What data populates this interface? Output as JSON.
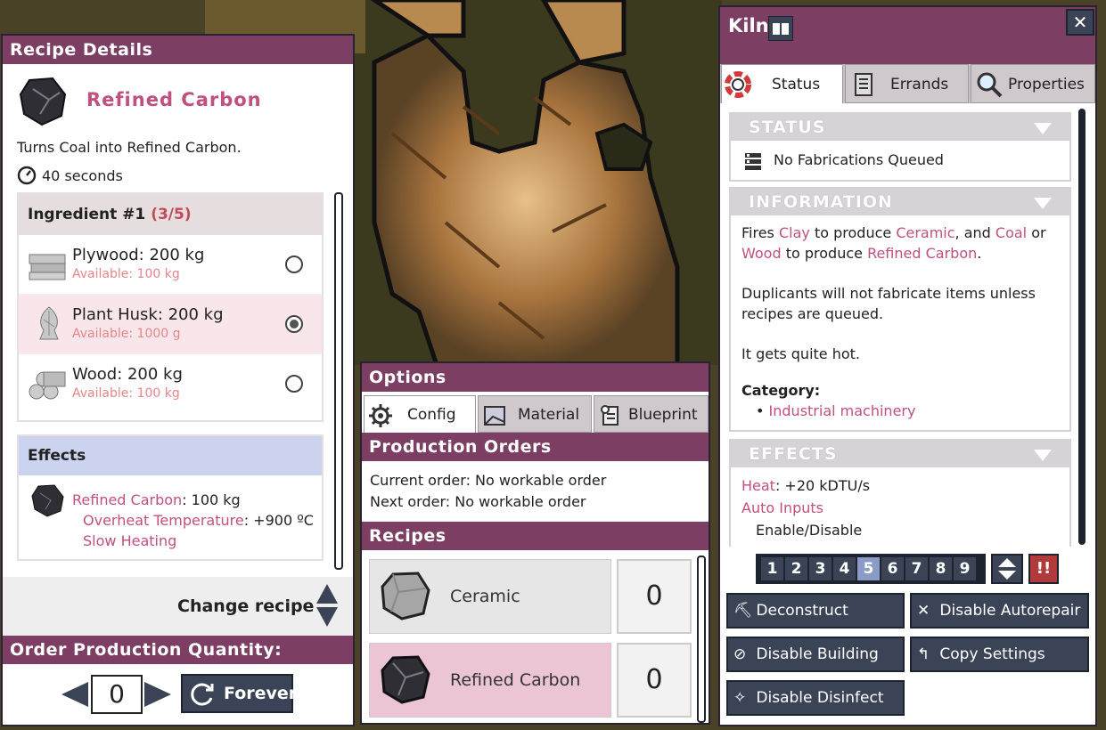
{
  "recipe_details": {
    "header": "Recipe Details",
    "name": "Refined Carbon",
    "description": "Turns Coal into Refined Carbon.",
    "time": "40 seconds",
    "ingredient_title": "Ingredient #1",
    "ingredient_count": "(3/5)",
    "ingredients": [
      {
        "name": "Plywood: 200 kg",
        "available": "Available: 100 kg",
        "selected": false
      },
      {
        "name": "Plant Husk: 200 kg",
        "available": "Available: 1000 g",
        "selected": true
      },
      {
        "name": "Wood: 200 kg",
        "available": "Available: 100 kg",
        "selected": false
      }
    ],
    "effects_title": "Effects",
    "effect_product": "Refined Carbon",
    "effect_amount": ": 100 kg",
    "effect_overheat_label": "Overheat Temperature",
    "effect_overheat_value": ": +900 ºC",
    "effect_slow": "Slow Heating",
    "change_recipe": "Change recipe",
    "order_header": "Order Production Quantity:",
    "quantity": "0",
    "forever": "Forever"
  },
  "options": {
    "header": "Options",
    "tabs": [
      "Config",
      "Material",
      "Blueprint"
    ],
    "production_orders_header": "Production Orders",
    "current_order": "Current order: No workable order",
    "next_order": "Next order: No workable order",
    "recipes_header": "Recipes",
    "recipes": [
      {
        "name": "Ceramic",
        "count": "0"
      },
      {
        "name": "Refined Carbon",
        "count": "0"
      }
    ]
  },
  "kiln": {
    "title": "Kiln",
    "close": "✕",
    "tabs": [
      "Status",
      "Errands",
      "Properties"
    ],
    "status_header": "STATUS",
    "status_text": "No Fabrications Queued",
    "info_header": "INFORMATION",
    "info_fires": "Fires ",
    "info_clay": "Clay",
    "info_to_produce": " to produce ",
    "info_ceramic": "Ceramic",
    "info_and": ", and ",
    "info_coal": "Coal",
    "info_or": " or",
    "info_wood": "Wood",
    "info_to_produce2": " to produce ",
    "info_refined": "Refined Carbon",
    "info_period": ".",
    "info_para2": "Duplicants will not fabricate items unless recipes are queued.",
    "info_para3": "It gets quite hot.",
    "category_label": "Category:",
    "category_value": "Industrial machinery",
    "effects_header": "EFFECTS",
    "heat_label": "Heat",
    "heat_value": ": +20 kDTU/s",
    "auto_inputs": "Auto Inputs",
    "enable_disable": "Enable/Disable",
    "priorities": [
      "1",
      "2",
      "3",
      "4",
      "5",
      "6",
      "7",
      "8",
      "9"
    ],
    "selected_priority": "5",
    "priority_alert": "!!",
    "buttons": {
      "deconstruct": "Deconstruct",
      "disable_autorepair": "Disable Autorepair",
      "disable_building": "Disable Building",
      "copy_settings": "Copy Settings",
      "disable_disinfect": "Disable Disinfect"
    }
  }
}
